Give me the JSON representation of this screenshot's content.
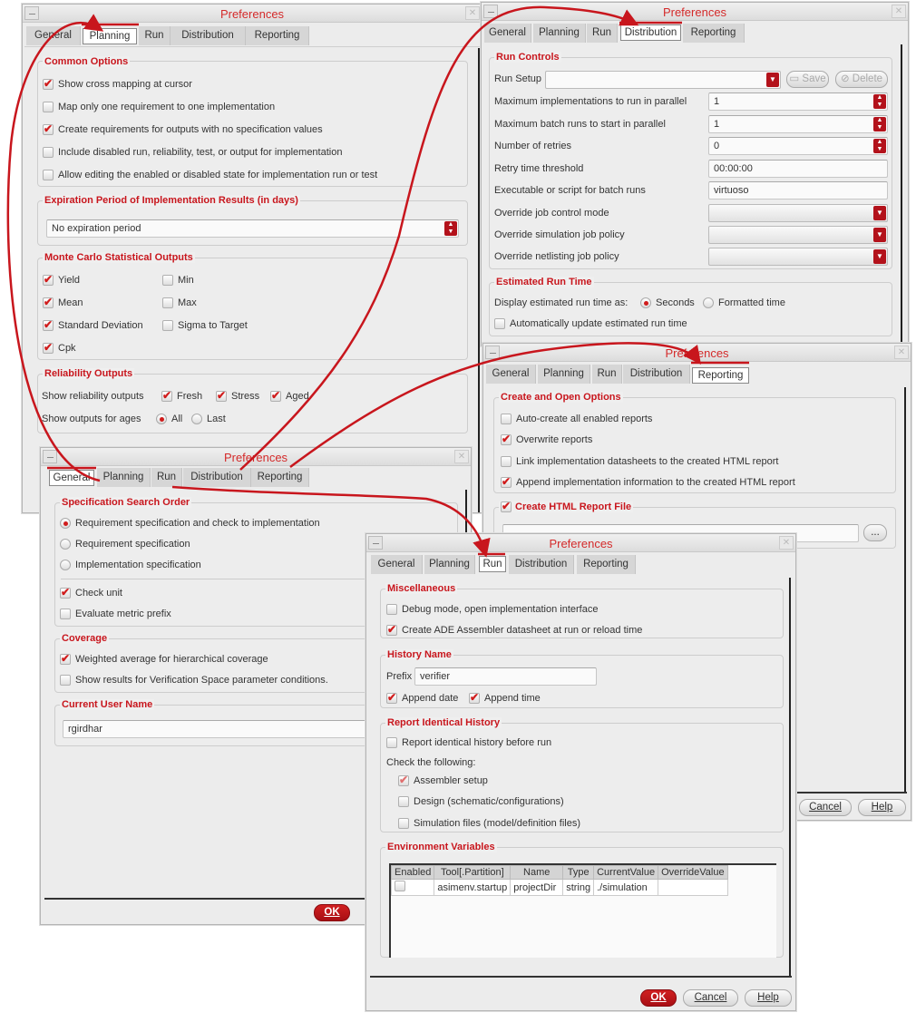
{
  "tabs": [
    "General",
    "Planning",
    "Run",
    "Distribution",
    "Reporting"
  ],
  "window_title": "Preferences",
  "planning": {
    "common_options": {
      "title": "Common Options",
      "items": [
        {
          "label": "Show cross mapping at cursor",
          "checked": true
        },
        {
          "label": "Map only one requirement to one implementation",
          "checked": false
        },
        {
          "label": "Create requirements for outputs with no specification values",
          "checked": true
        },
        {
          "label": "Include disabled run, reliability, test, or output for implementation",
          "checked": false
        },
        {
          "label": "Allow editing the enabled or disabled state for implementation run or test",
          "checked": false
        }
      ]
    },
    "expiration": {
      "title": "Expiration Period of Implementation Results (in days)",
      "value": "No expiration period"
    },
    "monte_carlo": {
      "title": "Monte Carlo Statistical Outputs",
      "items": [
        {
          "label": "Yield",
          "checked": true
        },
        {
          "label": "Mean",
          "checked": true
        },
        {
          "label": "Standard Deviation",
          "checked": true
        },
        {
          "label": "Cpk",
          "checked": true
        },
        {
          "label": "Min",
          "checked": false
        },
        {
          "label": "Max",
          "checked": false
        },
        {
          "label": "Sigma to Target",
          "checked": false
        }
      ]
    },
    "reliability": {
      "title": "Reliability Outputs",
      "show_label": "Show reliability outputs",
      "fresh": "Fresh",
      "stress": "Stress",
      "aged": "Aged",
      "ages_label": "Show outputs for ages",
      "all": "All",
      "last": "Last",
      "selected": "All"
    }
  },
  "distribution": {
    "run_controls": {
      "title": "Run Controls",
      "run_setup_label": "Run Setup",
      "run_setup_value": "",
      "save": "Save",
      "delete": "Delete",
      "fields": [
        {
          "label": "Maximum implementations to run in parallel",
          "value": "1"
        },
        {
          "label": "Maximum batch runs to start in parallel",
          "value": "1"
        },
        {
          "label": "Number of retries",
          "value": "0"
        },
        {
          "label": "Retry time threshold",
          "value": "00:00:00"
        },
        {
          "label": "Executable or script for batch runs",
          "value": "virtuoso"
        },
        {
          "label": "Override job control mode",
          "value": ""
        },
        {
          "label": "Override simulation job policy",
          "value": ""
        },
        {
          "label": "Override netlisting job policy",
          "value": ""
        }
      ]
    },
    "estimated": {
      "title": "Estimated Run Time",
      "display_label": "Display estimated run time as:",
      "seconds": "Seconds",
      "formatted": "Formatted time",
      "selected": "Seconds",
      "auto_update": "Automatically update estimated run time",
      "auto_update_checked": false
    }
  },
  "reporting": {
    "create_open": {
      "title": "Create and Open Options",
      "items": [
        {
          "label": "Auto-create all enabled reports",
          "checked": false
        },
        {
          "label": "Overwrite reports",
          "checked": true
        },
        {
          "label": "Link implementation datasheets to the created HTML report",
          "checked": false
        },
        {
          "label": "Append implementation information to the created HTML report",
          "checked": true
        }
      ]
    },
    "html_file": {
      "title": "Create HTML Report File",
      "checked": true,
      "value": "",
      "browse": "..."
    },
    "cancel": "Cancel",
    "help": "Help"
  },
  "general": {
    "search_order": {
      "title": "Specification Search Order",
      "options": [
        "Requirement specification and check to implementation",
        "Requirement specification",
        "Implementation specification"
      ],
      "selected": 0,
      "check_unit": "Check unit",
      "check_unit_checked": true,
      "metric_prefix": "Evaluate metric prefix",
      "metric_prefix_checked": false
    },
    "coverage": {
      "title": "Coverage",
      "items": [
        {
          "label": "Weighted average for hierarchical coverage",
          "checked": true
        },
        {
          "label": "Show results for Verification Space parameter conditions.",
          "checked": false
        }
      ]
    },
    "user": {
      "title": "Current User Name",
      "value": "rgirdhar"
    },
    "ok": "OK"
  },
  "run": {
    "misc": {
      "title": "Miscellaneous",
      "items": [
        {
          "label": "Debug mode, open implementation interface",
          "checked": false
        },
        {
          "label": "Create ADE Assembler datasheet at run or reload time",
          "checked": true
        }
      ]
    },
    "history": {
      "title": "History Name",
      "prefix_label": "Prefix",
      "prefix_value": "verifier",
      "append_date": "Append date",
      "append_time": "Append time"
    },
    "identical": {
      "title": "Report Identical History",
      "report_before": "Report identical history before run",
      "check_following": "Check the following:",
      "items": [
        {
          "label": "Assembler setup",
          "checked": true
        },
        {
          "label": "Design (schematic/configurations)",
          "checked": false
        },
        {
          "label": "Simulation files (model/definition files)",
          "checked": false
        }
      ]
    },
    "env": {
      "title": "Environment Variables",
      "columns": [
        "Enabled",
        "Tool[.Partition]",
        "Name",
        "Type",
        "CurrentValue",
        "OverrideValue"
      ],
      "rows": [
        {
          "enabled": false,
          "tool": "asimenv.startup",
          "name": "projectDir",
          "type": "string",
          "current": "./simulation",
          "override": ""
        }
      ]
    },
    "ok": "OK",
    "cancel": "Cancel",
    "help": "Help"
  },
  "colors": {
    "accent": "#d01c1c",
    "annotation": "#c8161d"
  }
}
